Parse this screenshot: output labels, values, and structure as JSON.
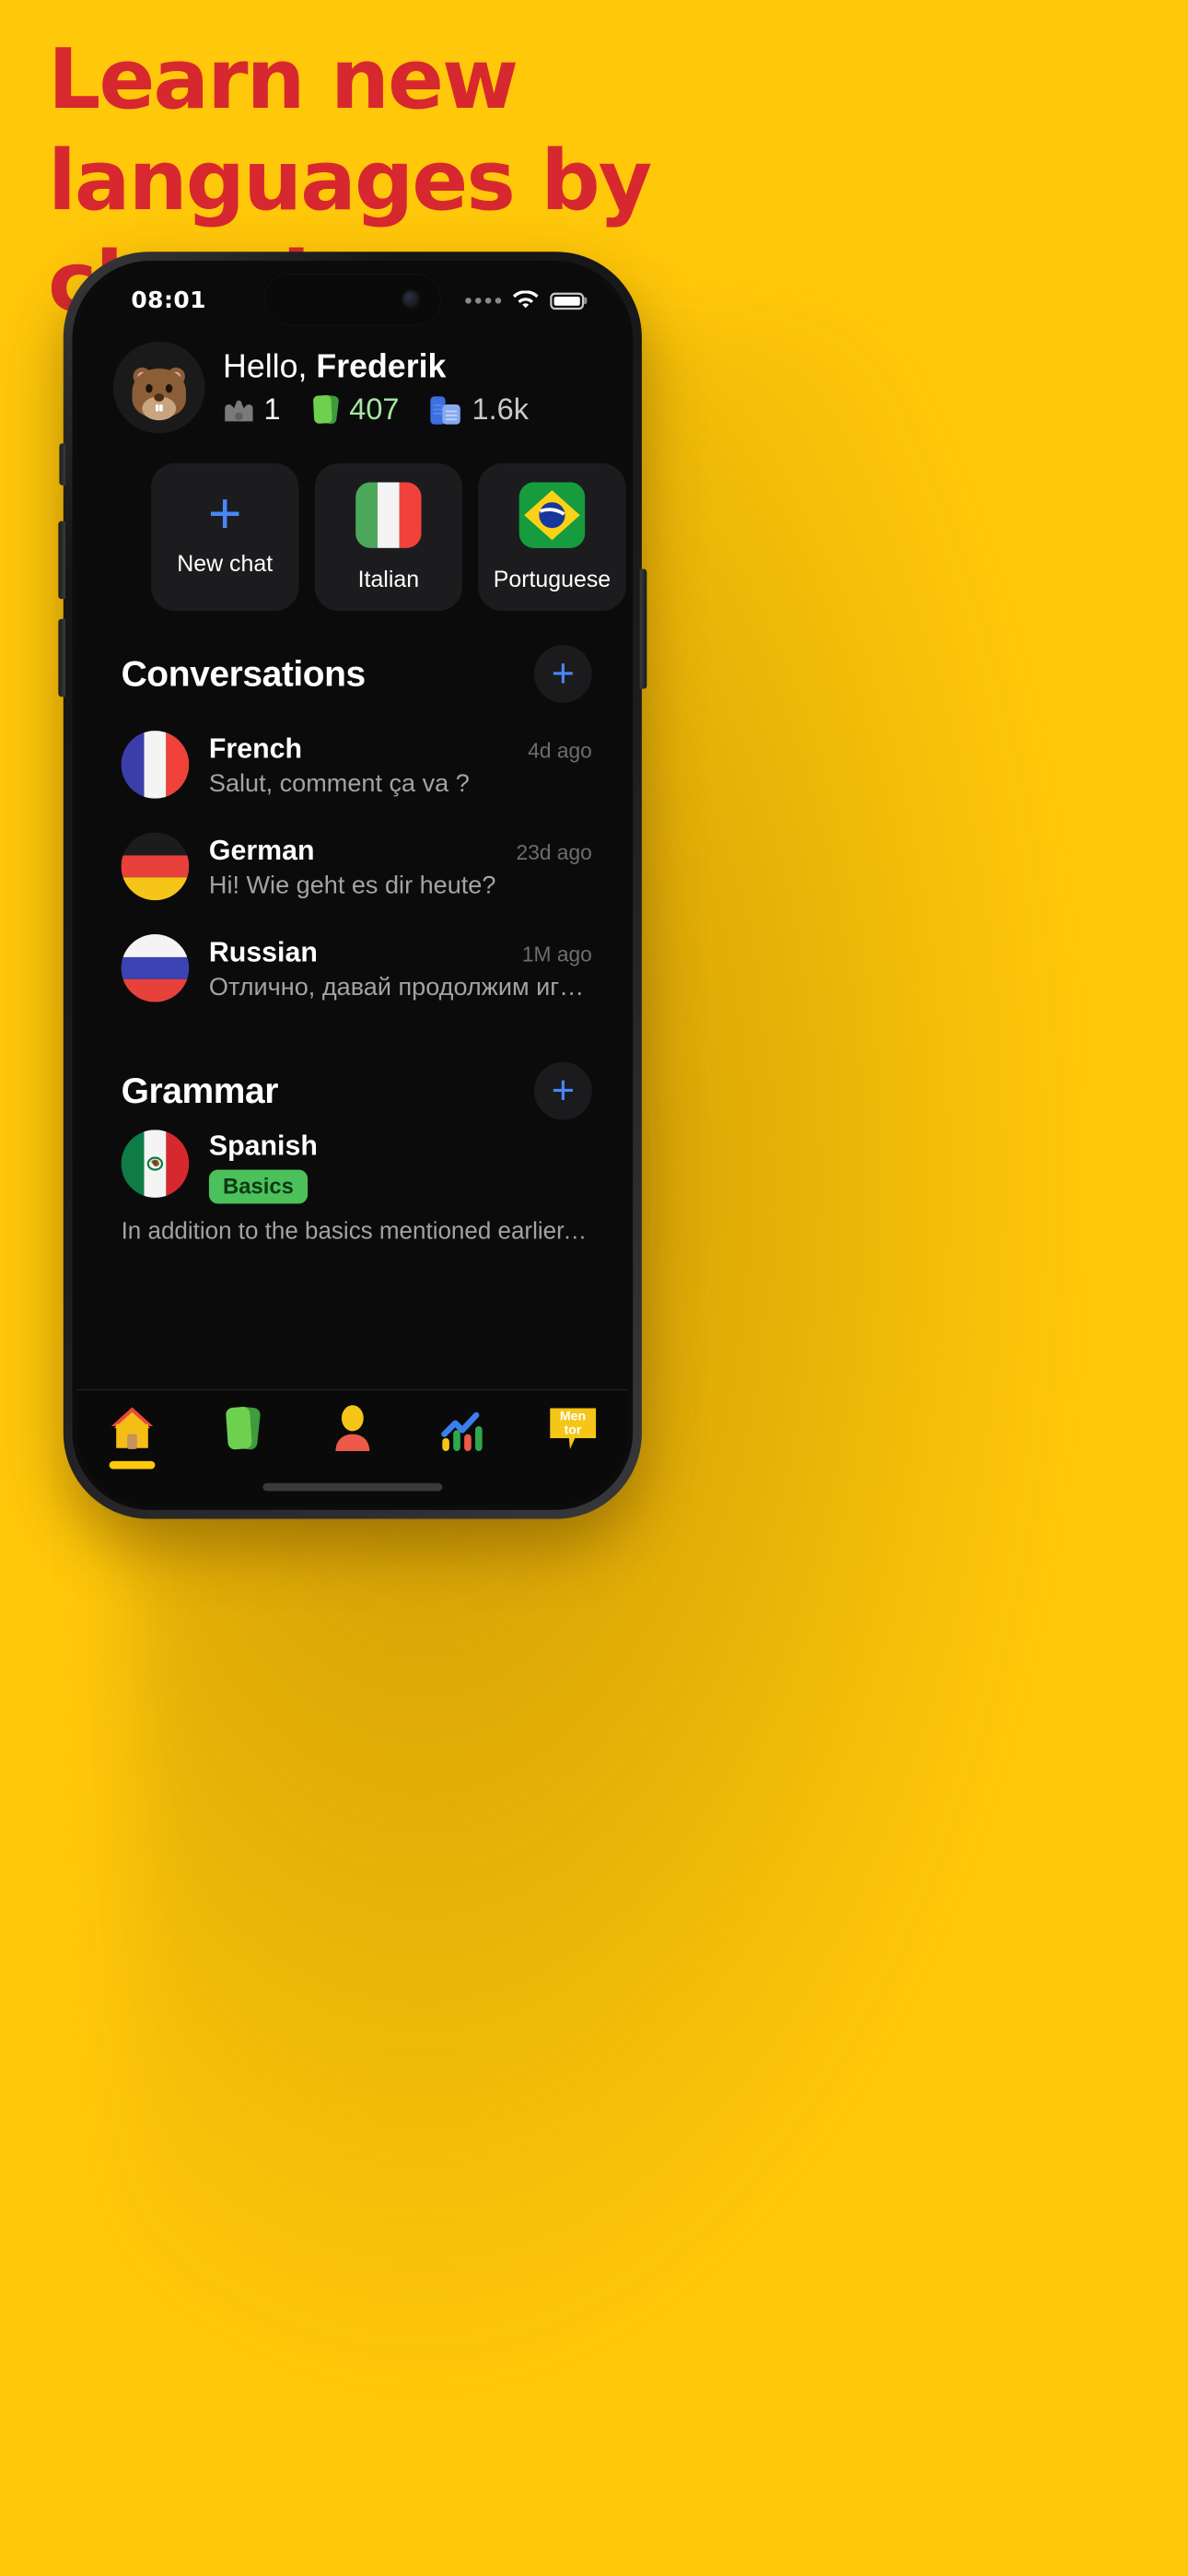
{
  "hero": {
    "lines": [
      "Learn new",
      "languages by",
      "chatting"
    ],
    "text_color": "#D8282F",
    "background_color": "#FFC80A"
  },
  "status_bar": {
    "time": "08:01",
    "signal_icon": "signal-dots-icon",
    "wifi_icon": "wifi-icon",
    "battery_icon": "battery-full-icon"
  },
  "greeting": {
    "avatar_icon": "beaver-avatar",
    "hello": "Hello, ",
    "name": "Frederik",
    "stats": [
      {
        "icon": "crown-icon",
        "value": "1",
        "color": "#ffffff"
      },
      {
        "icon": "cards-icon",
        "value": "407",
        "color": "#A8E6A1"
      },
      {
        "icon": "books-icon",
        "value": "1.6k",
        "color": "#c9c9c9"
      }
    ]
  },
  "language_cards": [
    {
      "type": "new",
      "icon": "plus-icon",
      "label": "New chat"
    },
    {
      "type": "flag",
      "icon": "flag-italy",
      "label": "Italian"
    },
    {
      "type": "flag",
      "icon": "flag-brazil",
      "label": "Portuguese"
    }
  ],
  "conversations": {
    "title": "Conversations",
    "add_icon": "plus-icon",
    "items": [
      {
        "flag": "flag-france",
        "name": "French",
        "message": "Salut, comment ça va ?",
        "time": "4d ago"
      },
      {
        "flag": "flag-germany",
        "name": "German",
        "message": "Hi! Wie geht es dir heute?",
        "time": "23d ago"
      },
      {
        "flag": "flag-russia",
        "name": "Russian",
        "message": "Отлично, давай продолжим игр...",
        "time": "1M ago"
      }
    ]
  },
  "grammar": {
    "title": "Grammar",
    "add_icon": "plus-icon",
    "items": [
      {
        "flag": "flag-mexico",
        "name": "Spanish",
        "badge": "Basics",
        "description": "In addition to the basics mentioned earlier, it's i..."
      }
    ]
  },
  "tabbar": {
    "items": [
      {
        "icon": "home-icon",
        "active": true
      },
      {
        "icon": "cards-icon",
        "active": false
      },
      {
        "icon": "person-icon",
        "active": false
      },
      {
        "icon": "chart-icon",
        "active": false
      },
      {
        "icon": "mentor-icon",
        "active": false
      }
    ],
    "mentor_label_line1": "Men",
    "mentor_label_line2": "tor",
    "active_indicator_color": "#FFC80A"
  },
  "colors": {
    "accent_blue": "#4A86F7",
    "badge_green": "#4CC15B",
    "brand_yellow": "#FFC80A",
    "headline_red": "#D8282F",
    "screen_bg": "#0b0b0b",
    "card_bg": "#1c1c1e"
  }
}
